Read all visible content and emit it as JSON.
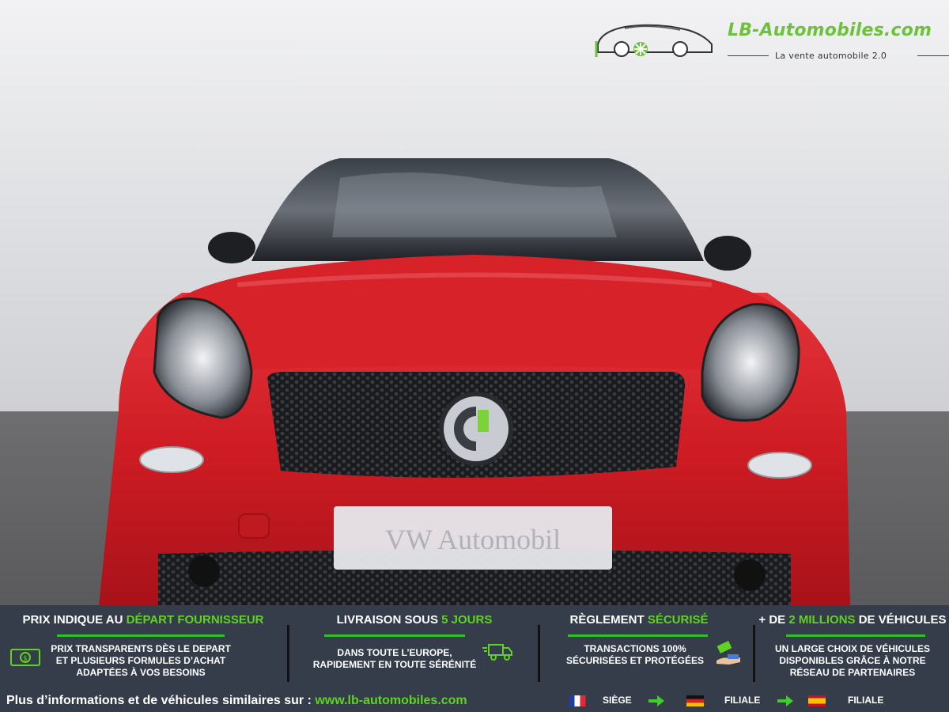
{
  "logo": {
    "name": "LB-Automobiles.com",
    "tagline": "La vente automobile 2.0"
  },
  "photo": {
    "plate_text": "VW Automobil"
  },
  "features": [
    {
      "title_plain": "PRIX INDIQUE AU ",
      "title_accent": "DÉPART FOURNISSEUR",
      "lines": [
        "PRIX TRANSPARENTS DÈS LE DEPART",
        "ET PLUSIEURS FORMULES D’ACHAT",
        "ADAPTÉES À VOS BESOINS"
      ],
      "icon": "money-icon"
    },
    {
      "title_plain": "LIVRAISON SOUS ",
      "title_accent": "5 JOURS",
      "lines": [
        "DANS TOUTE L’EUROPE,",
        "RAPIDEMENT EN TOUTE SÉRÉNITÉ"
      ],
      "icon": "delivery-truck-icon"
    },
    {
      "title_plain": "RÈGLEMENT ",
      "title_accent": "SÉCURISÉ",
      "lines": [
        "TRANSACTIONS 100%",
        "SÉCURISÉES ET PROTÉGÉES"
      ],
      "icon": "payment-hand-icon"
    },
    {
      "title_plain": "+ DE ",
      "title_accent": "2 MILLIONS",
      "title_end": " DE VÉHICULES",
      "lines": [
        "UN LARGE CHOIX DE VÉHICULES",
        "DISPONIBLES GRÂCE À NOTRE",
        "RÉSEAU DE PARTENAIRES"
      ]
    }
  ],
  "footer": {
    "info_text": "Plus d’informations et de véhicules similaires sur : ",
    "url": "www.lb-automobiles.com",
    "locations": [
      {
        "flag": "flag-france-icon",
        "label": "SIÈGE"
      },
      {
        "flag": "flag-germany-icon",
        "label": "FILIALE"
      },
      {
        "flag": "flag-spain-icon",
        "label": "FILIALE"
      }
    ]
  },
  "colors": {
    "banner_bg": "#353d4a",
    "accent_green": "#5fd324",
    "car_red": "#d21e26"
  }
}
